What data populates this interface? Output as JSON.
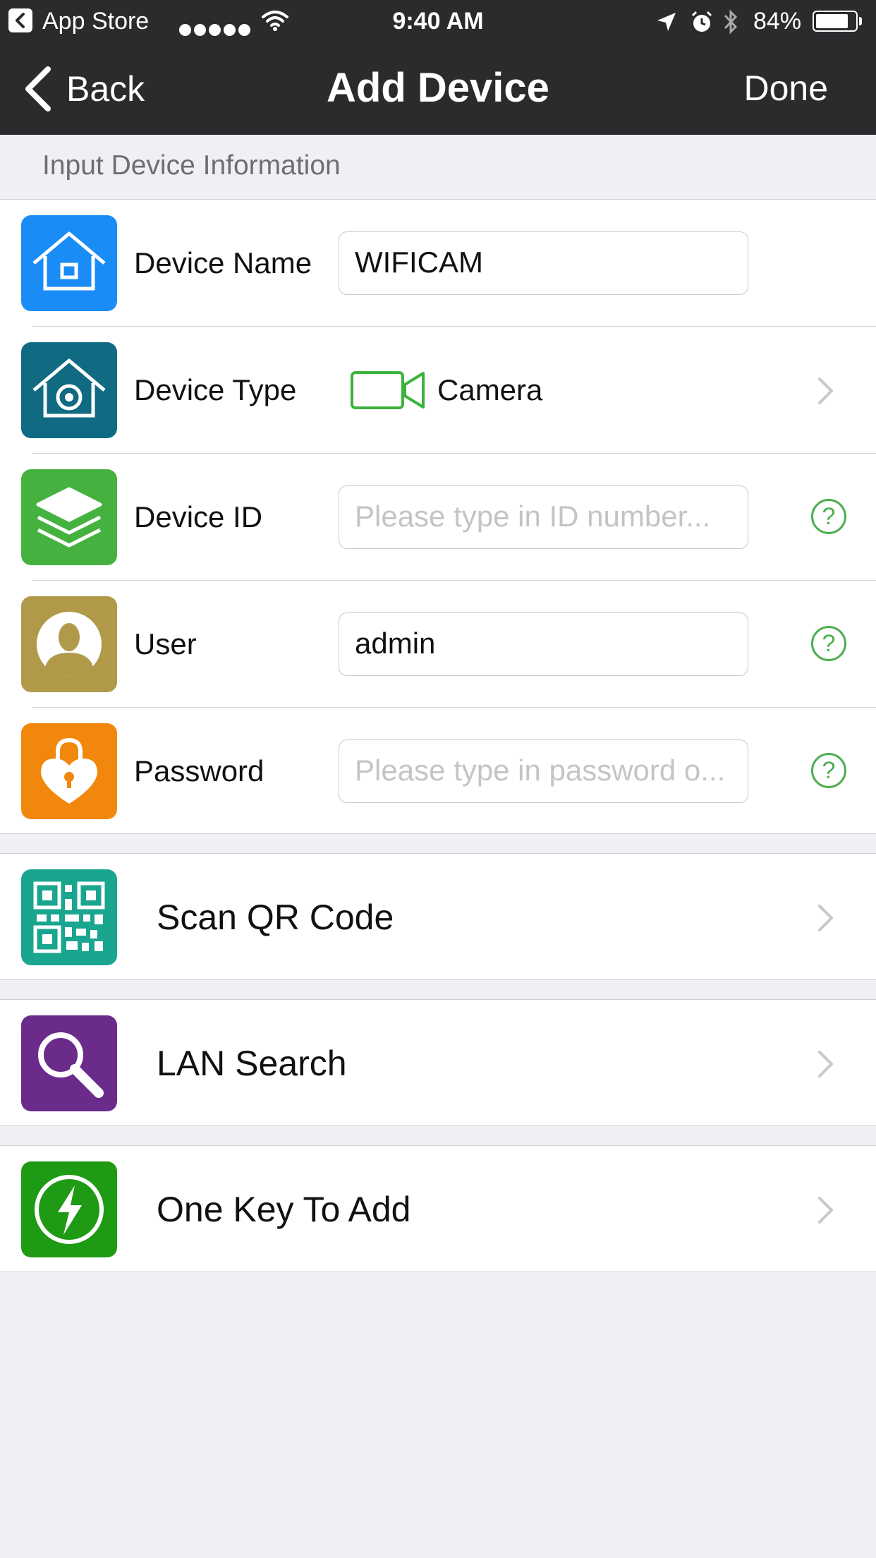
{
  "status_bar": {
    "back_app": "App Store",
    "time": "9:40 AM",
    "battery": "84%",
    "battery_level": 0.84
  },
  "nav": {
    "back_label": "Back",
    "title": "Add Device",
    "done_label": "Done"
  },
  "section_header": "Input Device Information",
  "form": {
    "device_name": {
      "label": "Device Name",
      "value": "WIFICAM"
    },
    "device_type": {
      "label": "Device Type",
      "value": "Camera"
    },
    "device_id": {
      "label": "Device ID",
      "value": "",
      "placeholder": "Please type in ID number..."
    },
    "user": {
      "label": "User",
      "value": "admin"
    },
    "password": {
      "label": "Password",
      "value": "",
      "placeholder": "Please type in password o..."
    }
  },
  "help_symbol": "?",
  "actions": {
    "scan_qr": "Scan QR Code",
    "lan_search": "LAN Search",
    "one_key": "One Key To Add"
  },
  "colors": {
    "bar": "#2b2b2e",
    "device_name_icon": "#1a8cf6",
    "device_type_icon": "#0f6a82",
    "device_id_icon": "#45b23f",
    "user_icon": "#b09a4a",
    "password_icon": "#f2870e",
    "qr_icon": "#1aa58f",
    "lan_icon": "#6a2b8b",
    "one_key_icon": "#1e9a14",
    "help_green": "#4caf50"
  }
}
